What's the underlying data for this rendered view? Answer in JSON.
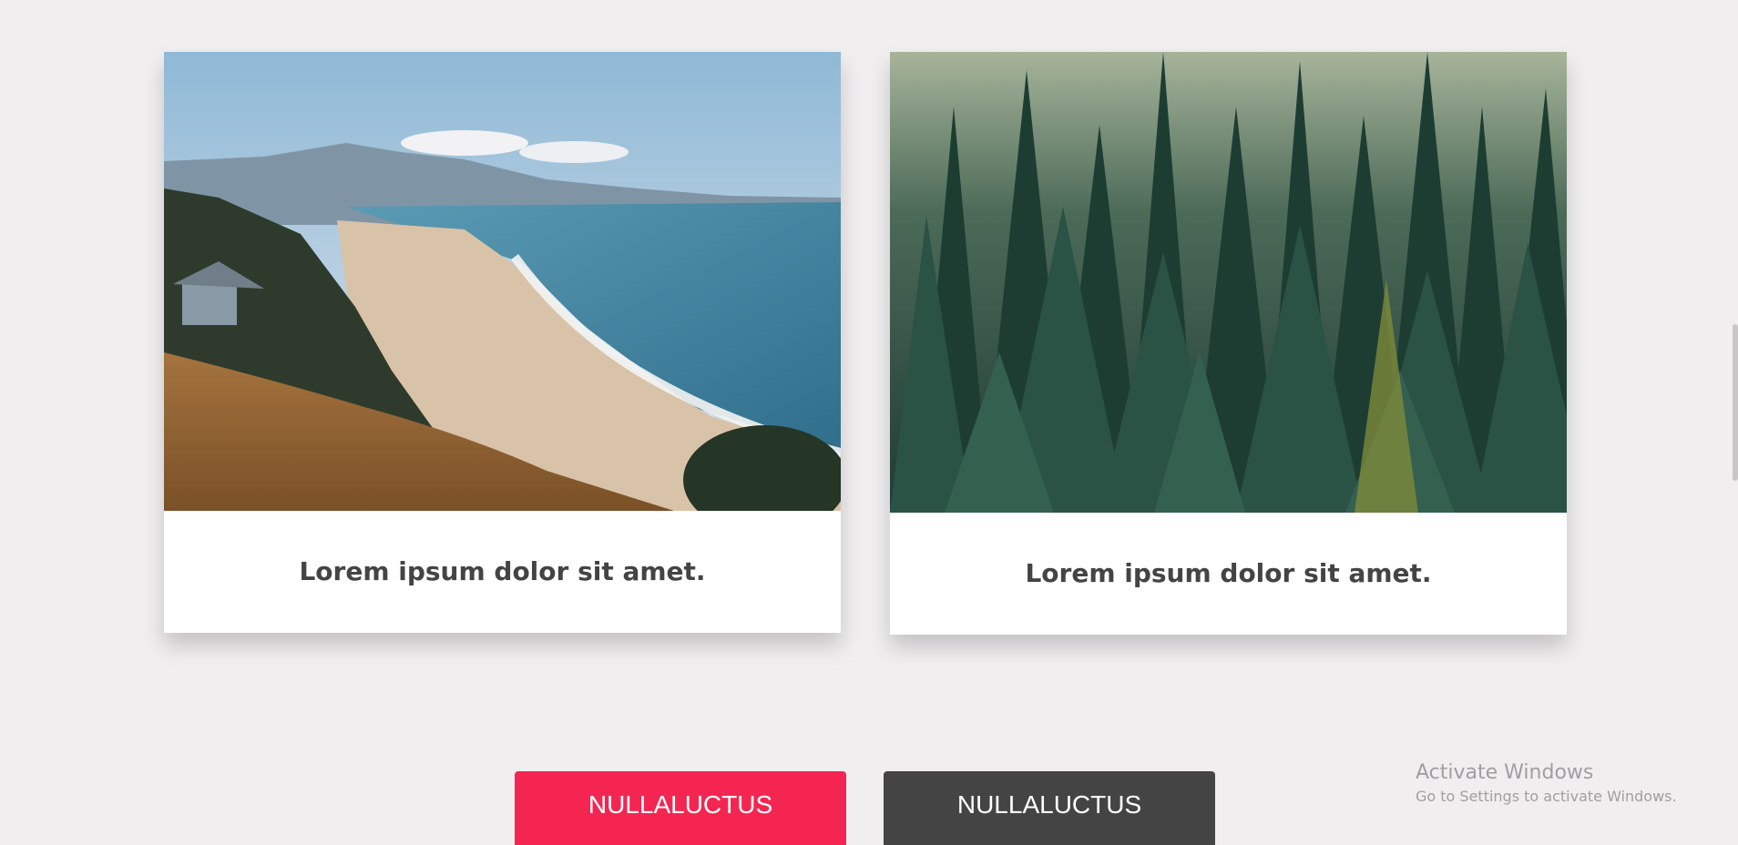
{
  "cards": [
    {
      "image": "coastline-beach-photo",
      "caption": "Lorem ipsum dolor sit amet."
    },
    {
      "image": "pine-forest-photo",
      "caption": "Lorem ipsum dolor sit amet."
    }
  ],
  "buttons": {
    "primary_label": "NULLALUCTUS",
    "secondary_label": "NULLALUCTUS",
    "primary_color": "#f42651",
    "secondary_color": "#444444"
  },
  "watermark": {
    "title": "Activate Windows",
    "subtitle": "Go to Settings to activate Windows."
  },
  "colors": {
    "background": "#f0eeef",
    "caption_text": "#444444"
  }
}
